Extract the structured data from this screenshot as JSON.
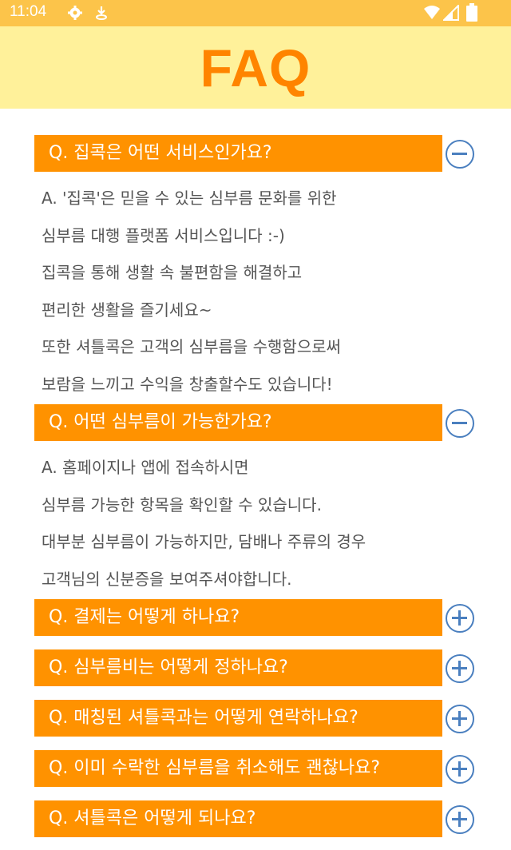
{
  "status_bar": {
    "time": "11:04",
    "icons": [
      "gear-icon",
      "download-icon",
      "wifi-icon",
      "signal-icon",
      "battery-icon"
    ]
  },
  "header": {
    "title": "FAQ"
  },
  "colors": {
    "status_bar": "#FCC44A",
    "header_bg": "#FFF19A",
    "title": "#FF8400",
    "question_bar": "#FF9200",
    "toggle_icon": "#4A7FBF",
    "answer_text": "#555555"
  },
  "faqs": [
    {
      "question": "Q. 집콕은 어떤 서비스인가요?",
      "expanded": true,
      "answer_lines": [
        "A. '집콕'은 믿을 수 있는 심부름 문화를 위한",
        "심부름 대행 플랫폼 서비스입니다 :-)",
        "집콕을 통해 생활 속 불편함을 해결하고",
        "편리한 생활을 즐기세요~",
        "또한 셔틀콕은 고객의 심부름을 수행함으로써",
        "보람을 느끼고 수익을 창출할수도 있습니다!"
      ]
    },
    {
      "question": "Q. 어떤 심부름이 가능한가요?",
      "expanded": true,
      "answer_lines": [
        "A. 홈페이지나 앱에 접속하시면",
        "심부름 가능한 항목을 확인할 수 있습니다.",
        "대부분 심부름이 가능하지만, 담배나 주류의 경우",
        "고객님의 신분증을 보여주셔야합니다."
      ]
    },
    {
      "question": "Q. 결제는 어떻게 하나요?",
      "expanded": false,
      "answer_lines": []
    },
    {
      "question": "Q. 심부름비는 어떻게 정하나요?",
      "expanded": false,
      "answer_lines": []
    },
    {
      "question": "Q. 매칭된 셔틀콕과는 어떻게 연락하나요?",
      "expanded": false,
      "answer_lines": []
    },
    {
      "question": "Q. 이미 수락한 심부름을 취소해도 괜찮나요?",
      "expanded": false,
      "answer_lines": []
    },
    {
      "question": "Q. 셔틀콕은 어떻게 되나요?",
      "expanded": false,
      "answer_lines": []
    }
  ]
}
